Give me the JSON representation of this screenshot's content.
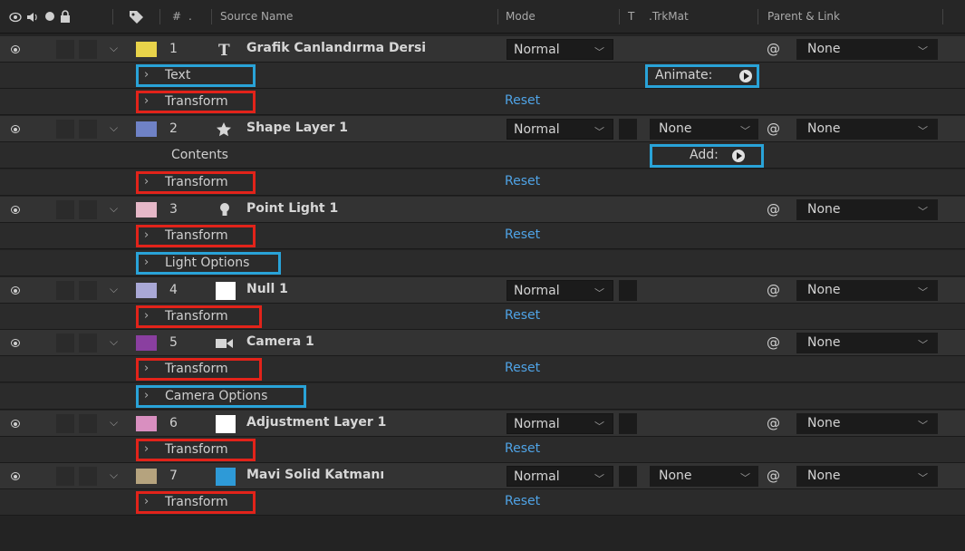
{
  "header": {
    "hash": "#",
    "dot": ".",
    "source_name": "Source Name",
    "mode": "Mode",
    "t": "T",
    "trkmat": ".TrkMat",
    "parent_link": "Parent & Link"
  },
  "common": {
    "reset": "Reset",
    "transform": "Transform",
    "normal": "Normal",
    "none": "None",
    "contents": "Contents",
    "animate": "Animate:",
    "add": "Add:",
    "text": "Text",
    "light_options": "Light Options",
    "camera_options": "Camera Options"
  },
  "layers": [
    {
      "num": "1",
      "name": "Grafik Canlandırma Dersi",
      "label_color": "#e8d34a",
      "icon": "text-icon"
    },
    {
      "num": "2",
      "name": "Shape Layer 1",
      "label_color": "#6f82c6",
      "icon": "star-icon"
    },
    {
      "num": "3",
      "name": "Point Light 1",
      "label_color": "#e6b8c8",
      "icon": "light-bulb-icon"
    },
    {
      "num": "4",
      "name": "Null 1",
      "label_color": "#a9a8d6",
      "icon": "null-square-icon"
    },
    {
      "num": "5",
      "name": "Camera 1",
      "label_color": "#8a3fa0",
      "icon": "camera-icon"
    },
    {
      "num": "6",
      "name": "Adjustment Layer 1",
      "label_color": "#d98fc0",
      "icon": "adjustment-square-icon"
    },
    {
      "num": "7",
      "name": "Mavi Solid Katmanı",
      "label_color": "#b5a37e",
      "icon": "solid-square-icon"
    }
  ],
  "colors": {
    "highlight_red": "#e2231a",
    "highlight_blue": "#29a3d8",
    "reset_blue": "#4fa3e6"
  }
}
